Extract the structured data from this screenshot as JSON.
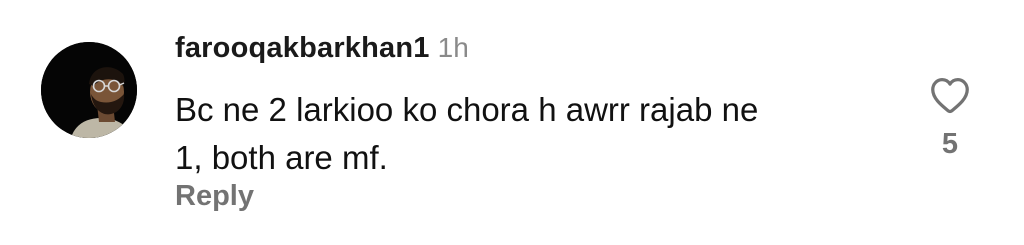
{
  "comment": {
    "username": "farooqakbarkhan1",
    "timestamp": "1h",
    "text": "Bc ne 2 larkioo ko chora h awrr rajab ne\n1, both are mf.",
    "reply_label": "Reply",
    "like_count": "5",
    "like_icon": "heart-outline-icon",
    "avatar_icon": "profile-photo"
  },
  "colors": {
    "username": "#1a1a1a",
    "timestamp": "#8a8a8a",
    "secondary_action": "#737373",
    "background": "#ffffff"
  }
}
